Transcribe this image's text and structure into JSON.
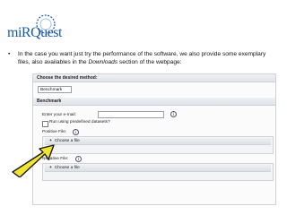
{
  "logo": {
    "text": "miRQuest"
  },
  "bullet": {
    "marker": "•",
    "text_before": "In the case you want just try the performance of the software, we also provide some exemplary files, also availables in the ",
    "text_italic": "Downloads",
    "text_after": " section of the webpage:"
  },
  "form": {
    "method_header": "Choose the desired method:",
    "method_selected": "Benchmark",
    "benchmark_header": "Benchmark",
    "email_label": "Enter your e-mail:",
    "email_value": "",
    "predefined_label": "Run using predefined datasets?",
    "positive_label": "Positive File:",
    "negative_label": "Negative File:",
    "choose_file": "Choose a file",
    "info_glyph": "i"
  },
  "colors": {
    "arrow_fill": "#f2e530",
    "arrow_stroke": "#1a1a1a",
    "brand": "#1a5aa8"
  }
}
